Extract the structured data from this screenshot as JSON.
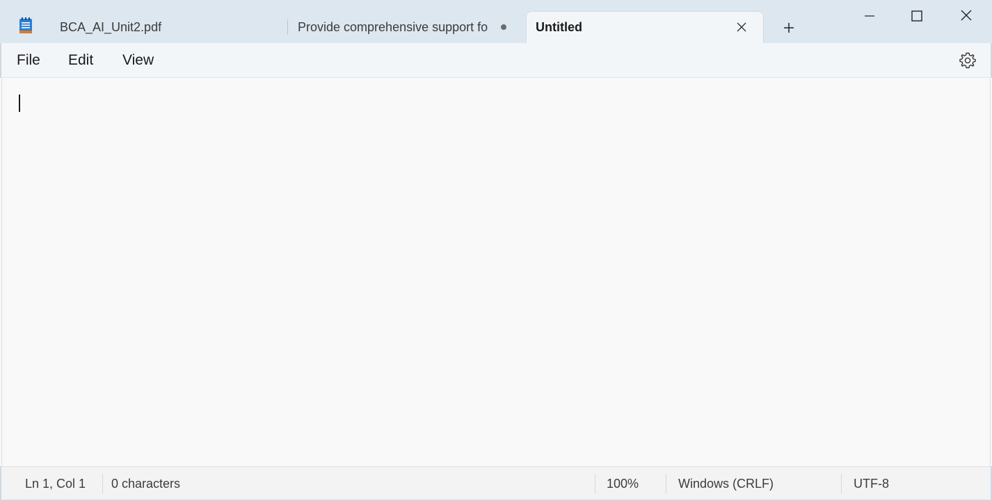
{
  "tabs": [
    {
      "label": "BCA_AI_Unit2.pdf",
      "active": false,
      "unsaved": false
    },
    {
      "label": "Provide comprehensive support for",
      "active": false,
      "unsaved": true
    },
    {
      "label": "Untitled",
      "active": true,
      "unsaved": false
    }
  ],
  "menu": {
    "file": "File",
    "edit": "Edit",
    "view": "View"
  },
  "editor": {
    "content": ""
  },
  "status": {
    "position": "Ln 1, Col 1",
    "characters": "0 characters",
    "zoom": "100%",
    "line_ending": "Windows (CRLF)",
    "encoding": "UTF-8"
  },
  "icons": {
    "app": "notepad-icon",
    "tab_close": "close-icon",
    "new_tab": "plus-icon",
    "settings": "gear-icon",
    "minimize": "minimize-icon",
    "maximize": "maximize-icon",
    "close": "close-icon"
  },
  "colors": {
    "titlebar": "#dde7ef",
    "active_tab": "#f3f6f9",
    "editor_bg": "#f9f9f9"
  }
}
